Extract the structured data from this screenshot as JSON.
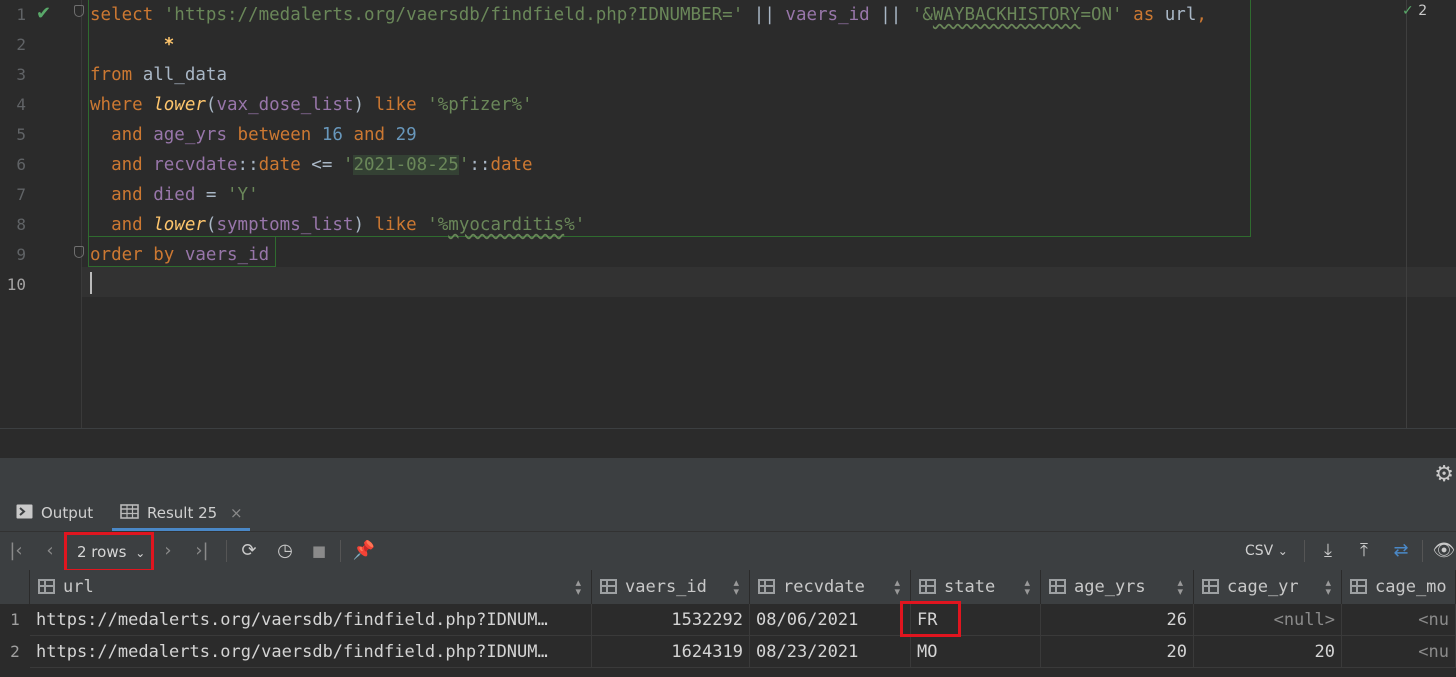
{
  "editor": {
    "line_numbers": [
      "1",
      "2",
      "3",
      "4",
      "5",
      "6",
      "7",
      "8",
      "9",
      "10"
    ],
    "inspection_count": "2",
    "lines": [
      [
        [
          "kw",
          "select"
        ],
        [
          "plain",
          " "
        ],
        [
          "str",
          "'https://medalerts.org/vaersdb/findfield.php?IDNUMBER='"
        ],
        [
          "plain",
          " || "
        ],
        [
          "col",
          "vaers_id"
        ],
        [
          "plain",
          " || "
        ],
        [
          "str",
          "'&"
        ],
        [
          "strtypo",
          "WAYBACKHISTORY"
        ],
        [
          "str",
          "=ON'"
        ],
        [
          "plain",
          " "
        ],
        [
          "kw",
          "as"
        ],
        [
          "plain",
          " url"
        ],
        [
          "kw",
          ","
        ]
      ],
      [
        [
          "plain",
          "       "
        ],
        [
          "star",
          "*"
        ]
      ],
      [
        [
          "kw",
          "from"
        ],
        [
          "plain",
          " all_data"
        ]
      ],
      [
        [
          "kw",
          "where"
        ],
        [
          "plain",
          " "
        ],
        [
          "fn",
          "lower"
        ],
        [
          "plain",
          "("
        ],
        [
          "col",
          "vax_dose_list"
        ],
        [
          "plain",
          ") "
        ],
        [
          "kw",
          "like"
        ],
        [
          "plain",
          " "
        ],
        [
          "str",
          "'%pfizer%'"
        ]
      ],
      [
        [
          "plain",
          "  "
        ],
        [
          "kw",
          "and"
        ],
        [
          "plain",
          " "
        ],
        [
          "col",
          "age_yrs"
        ],
        [
          "plain",
          " "
        ],
        [
          "kw",
          "between"
        ],
        [
          "plain",
          " "
        ],
        [
          "num",
          "16"
        ],
        [
          "plain",
          " "
        ],
        [
          "kw",
          "and"
        ],
        [
          "plain",
          " "
        ],
        [
          "num",
          "29"
        ]
      ],
      [
        [
          "plain",
          "  "
        ],
        [
          "kw",
          "and"
        ],
        [
          "plain",
          " "
        ],
        [
          "col",
          "recvdate"
        ],
        [
          "plain",
          "::"
        ],
        [
          "kw",
          "date"
        ],
        [
          "plain",
          " <= "
        ],
        [
          "str",
          "'"
        ],
        [
          "strhl",
          "2021-08-25"
        ],
        [
          "str",
          "'"
        ],
        [
          "plain",
          "::"
        ],
        [
          "kw",
          "date"
        ]
      ],
      [
        [
          "plain",
          "  "
        ],
        [
          "kw",
          "and"
        ],
        [
          "plain",
          " "
        ],
        [
          "col",
          "died"
        ],
        [
          "plain",
          " = "
        ],
        [
          "str",
          "'Y'"
        ]
      ],
      [
        [
          "plain",
          "  "
        ],
        [
          "kw",
          "and"
        ],
        [
          "plain",
          " "
        ],
        [
          "fn",
          "lower"
        ],
        [
          "plain",
          "("
        ],
        [
          "col",
          "symptoms_list"
        ],
        [
          "plain",
          ") "
        ],
        [
          "kw",
          "like"
        ],
        [
          "plain",
          " "
        ],
        [
          "str",
          "'%"
        ],
        [
          "strtypo",
          "myocarditis"
        ],
        [
          "str",
          "%'"
        ]
      ],
      [
        [
          "kw",
          "order"
        ],
        [
          "plain",
          " "
        ],
        [
          "kw",
          "by"
        ],
        [
          "plain",
          " "
        ],
        [
          "col",
          "vaers_id"
        ]
      ],
      []
    ]
  },
  "tabs": {
    "output_label": "Output",
    "result_label": "Result 25",
    "close_glyph": "×"
  },
  "toolbar": {
    "rows_label": "2 rows",
    "export_format": "CSV"
  },
  "grid": {
    "columns": [
      {
        "name": "url"
      },
      {
        "name": "vaers_id"
      },
      {
        "name": "recvdate"
      },
      {
        "name": "state"
      },
      {
        "name": "age_yrs"
      },
      {
        "name": "cage_yr"
      },
      {
        "name": "cage_mo"
      }
    ],
    "rows": [
      {
        "num": "1",
        "cells": [
          "https://medalerts.org/vaersdb/findfield.php?IDNUM…",
          "1532292",
          "08/06/2021",
          "FR",
          "26",
          "<null>",
          "<nu"
        ]
      },
      {
        "num": "2",
        "cells": [
          "https://medalerts.org/vaersdb/findfield.php?IDNUM…",
          "1624319",
          "08/23/2021",
          "MO",
          "20",
          "20",
          "<nu"
        ]
      }
    ]
  },
  "colors": {
    "keyword": "#cc7832",
    "string": "#6a8759",
    "column": "#9876aa",
    "function": "#ffc66d",
    "number": "#6897bb",
    "highlight_red": "#e0151f",
    "accent": "#4a88c7"
  },
  "icons": {
    "status": "check-icon",
    "settings": "gear-icon",
    "output": "terminal-icon",
    "result": "table-icon"
  }
}
